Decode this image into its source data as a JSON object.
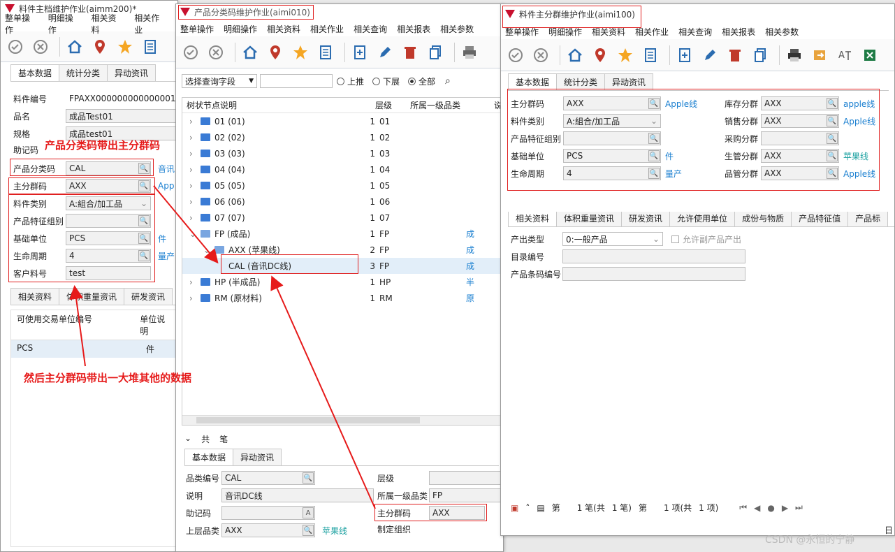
{
  "win1": {
    "title": "料件主档维护作业(aimm200)*",
    "menu": [
      "整单操作",
      "明细操作",
      "相关资料",
      "相关作业"
    ],
    "tabs": [
      "基本数据",
      "统计分类",
      "异动资讯"
    ],
    "fields": [
      {
        "label": "料件编号",
        "value": "FPAXX000000000000001"
      },
      {
        "label": "品名",
        "value": "成品Test01"
      },
      {
        "label": "规格",
        "value": "成品test01"
      },
      {
        "label": "助记码",
        "value": ""
      },
      {
        "label": "产品分类码",
        "value": "CAL",
        "extra": "音讯"
      },
      {
        "label": "主分群码",
        "value": "AXX",
        "extra": "App"
      },
      {
        "label": "料件类别",
        "value": "A:組合/加工品"
      },
      {
        "label": "产品特征组别",
        "value": ""
      },
      {
        "label": "基础单位",
        "value": "PCS",
        "extra": "件"
      },
      {
        "label": "生命周期",
        "value": "4",
        "extra": "量产"
      },
      {
        "label": "客户料号",
        "value": "test"
      }
    ],
    "bottom_tabs": [
      "相关资料",
      "体积重量资讯",
      "研发资讯"
    ],
    "grid_headers": [
      "可使用交易单位编号",
      "单位说明"
    ],
    "grid_row": [
      "PCS",
      "件"
    ]
  },
  "win2": {
    "title": "产品分类码维护作业(aimi010)",
    "menu": [
      "整单操作",
      "明细操作",
      "相关资料",
      "相关作业",
      "相关查询",
      "相关报表",
      "相关参数"
    ],
    "query_select": "选择查询字段",
    "radios": [
      "上推",
      "下展",
      "全部"
    ],
    "tree_headers": [
      "树状节点说明",
      "层级",
      "所属一级品类",
      "说"
    ],
    "tree": [
      {
        "label": "01 (01)",
        "level": "1",
        "cat": "01",
        "note": ""
      },
      {
        "label": "02 (02)",
        "level": "1",
        "cat": "02",
        "note": ""
      },
      {
        "label": "03 (03)",
        "level": "1",
        "cat": "03",
        "note": ""
      },
      {
        "label": "04 (04)",
        "level": "1",
        "cat": "04",
        "note": ""
      },
      {
        "label": "05 (05)",
        "level": "1",
        "cat": "05",
        "note": ""
      },
      {
        "label": "06 (06)",
        "level": "1",
        "cat": "06",
        "note": ""
      },
      {
        "label": "07 (07)",
        "level": "1",
        "cat": "07",
        "note": ""
      },
      {
        "label": "FP (成品)",
        "level": "1",
        "cat": "FP",
        "note": "成"
      },
      {
        "label": "AXX (苹果线)",
        "level": "2",
        "cat": "FP",
        "note": "成"
      },
      {
        "label": "CAL (音讯DC线)",
        "level": "3",
        "cat": "FP",
        "note": "成"
      },
      {
        "label": "HP (半成品)",
        "level": "1",
        "cat": "HP",
        "note": "半"
      },
      {
        "label": "RM (原材料)",
        "level": "1",
        "cat": "RM",
        "note": "原"
      }
    ],
    "count_text": "共",
    "count_unit": "笔",
    "tabs": [
      "基本数据",
      "异动资讯"
    ],
    "fields": {
      "code_label": "品类编号",
      "code": "CAL",
      "desc_label": "说明",
      "desc": "音讯DC线",
      "memo_label": "助记码",
      "memo": "",
      "parent_label": "上层品类",
      "parent": "AXX",
      "parent_link": "苹果线",
      "level_label": "层级",
      "level": "",
      "top_label": "所属一级品类",
      "top": "FP",
      "group_label": "主分群码",
      "group": "AXX",
      "org_label": "制定组织"
    }
  },
  "win3": {
    "title": "料件主分群维护作业(aimi100)",
    "menu": [
      "整单操作",
      "明细操作",
      "相关资料",
      "相关作业",
      "相关查询",
      "相关报表",
      "相关参数"
    ],
    "tabs": [
      "基本数据",
      "统计分类",
      "异动资讯"
    ],
    "left_fields": [
      {
        "label": "主分群码",
        "value": "AXX",
        "extra": "Apple线"
      },
      {
        "label": "料件类别",
        "value": "A:組合/加工品",
        "extra": ""
      },
      {
        "label": "产品特征组别",
        "value": "",
        "extra": ""
      },
      {
        "label": "基础单位",
        "value": "PCS",
        "extra": "件"
      },
      {
        "label": "生命周期",
        "value": "4",
        "extra": "量产"
      }
    ],
    "right_fields": [
      {
        "label": "库存分群",
        "value": "AXX",
        "extra": "apple线"
      },
      {
        "label": "销售分群",
        "value": "AXX",
        "extra": "Apple线"
      },
      {
        "label": "采购分群",
        "value": "",
        "extra": ""
      },
      {
        "label": "生管分群",
        "value": "AXX",
        "extra": "苹果线"
      },
      {
        "label": "品管分群",
        "value": "AXX",
        "extra": "Apple线"
      }
    ],
    "bottom_tabs": [
      "相关资料",
      "体积重量资讯",
      "研发资讯",
      "允许使用单位",
      "成份与物质",
      "产品特征值",
      "产品标"
    ],
    "output_type_label": "产出类型",
    "output_type": "0:一般产品",
    "allow_label": "允许副产品产出",
    "catalog_label": "目录编号",
    "barcode_label": "产品条码编号",
    "pager": {
      "a": "第",
      "b": "1 笔(共",
      "c": "1 笔)",
      "d": "第",
      "e": "1 项(共",
      "f": "1 项)"
    }
  },
  "annotations": {
    "a1": "产品分类码带出主分群码",
    "a2": "然后主分群码带出一大堆其他的数据"
  },
  "watermark": "CSDN @永恒的宁静",
  "edge_text": "日"
}
